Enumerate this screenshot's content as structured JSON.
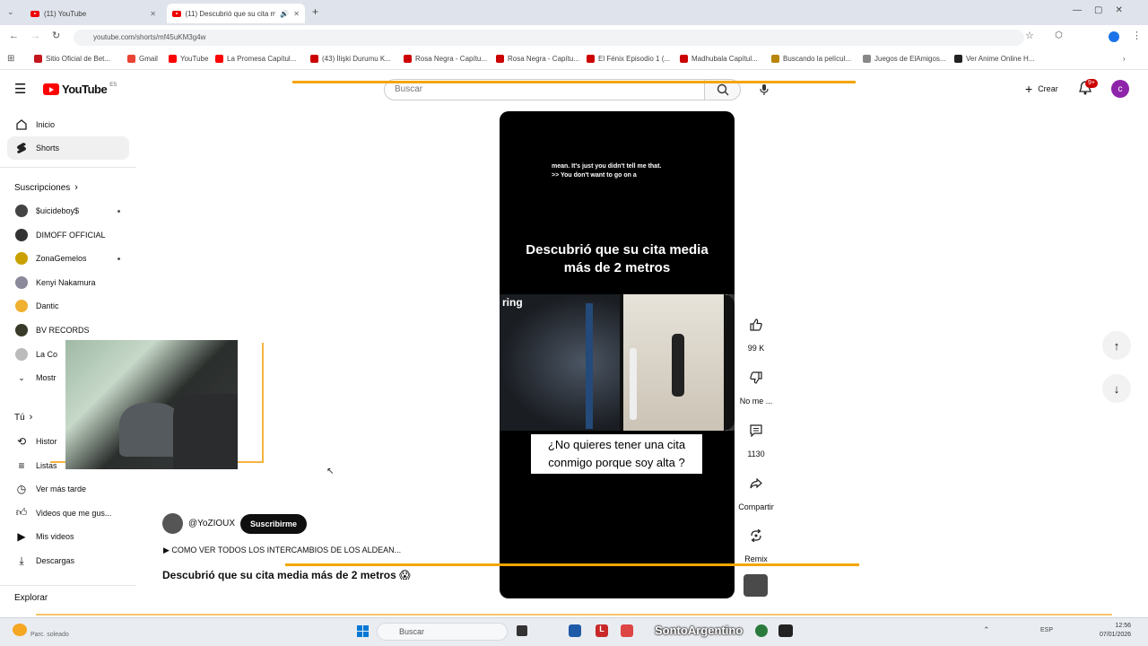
{
  "browser": {
    "tabs": [
      {
        "title": "(11) YouTube",
        "active": false
      },
      {
        "title": "(11) Descubrió que su cita me",
        "active": true
      }
    ],
    "url": "youtube.com/shorts/mf45uKM3g4w",
    "bookmarks": [
      {
        "label": "Sitio Oficial de Bet...",
        "color": "#c4161c"
      },
      {
        "label": "Gmail",
        "color": "#ea4335"
      },
      {
        "label": "YouTube",
        "color": "#ff0000"
      },
      {
        "label": "La Promesa Capítul...",
        "color": "#ff0000"
      },
      {
        "label": "(43) İlişki Durumu K...",
        "color": "#cc0000"
      },
      {
        "label": "Rosa Negra - Capítu...",
        "color": "#cc0000"
      },
      {
        "label": "Rosa Negra - Capítu...",
        "color": "#cc0000"
      },
      {
        "label": "El Fénix Episodio 1 (...",
        "color": "#cc0000"
      },
      {
        "label": "Madhubala Capítul...",
        "color": "#cc0000"
      },
      {
        "label": "Buscando la películ...",
        "color": "#b8860b"
      },
      {
        "label": "Juegos de ElAmigos...",
        "color": "#888888"
      },
      {
        "label": "Ver Anime Online H...",
        "color": "#222222"
      }
    ]
  },
  "header": {
    "logo_text": "YouTube",
    "country": "ES",
    "search_placeholder": "Buscar",
    "create_label": "Crear",
    "notif_count": "9+",
    "avatar_letter": "c"
  },
  "sidebar": {
    "main": [
      {
        "label": "Inicio",
        "icon": "home-icon"
      },
      {
        "label": "Shorts",
        "icon": "shorts-icon",
        "active": true
      }
    ],
    "subs_title": "Suscripciones",
    "subs": [
      {
        "label": "$uicideboy$",
        "color": "#444444",
        "dot": true
      },
      {
        "label": "DIMOFF OFFICIAL",
        "color": "#333333",
        "dot": false
      },
      {
        "label": "ZonaGemelos",
        "color": "#c9a100",
        "dot": true
      },
      {
        "label": "Kenyi Nakamura",
        "color": "#8a8a9a",
        "dot": false
      },
      {
        "label": "Dantic",
        "color": "#f0b030",
        "dot": false
      },
      {
        "label": "BV RECORDS",
        "color": "#3a3a2a",
        "dot": false
      },
      {
        "label": "La Co",
        "color": "#bbbbbb",
        "dot": false
      },
      {
        "label": "Mostr",
        "color": "",
        "dot": false
      }
    ],
    "you_title": "Tú",
    "you": [
      {
        "label": "Histor",
        "icon": "history-icon"
      },
      {
        "label": "Listas",
        "icon": "playlists-icon"
      },
      {
        "label": "Ver más tarde",
        "icon": "watch-later-icon"
      },
      {
        "label": "Videos que me gus...",
        "icon": "like-icon"
      },
      {
        "label": "Mis videos",
        "icon": "my-videos-icon"
      },
      {
        "label": "Descargas",
        "icon": "downloads-icon"
      }
    ],
    "explore_title": "Explorar"
  },
  "short": {
    "caption_line1": "mean. It's just you didn't tell me that.",
    "caption_line2": ">> You don't want to go on a",
    "title_overlay": "Descubrió que su cita media más de 2 metros",
    "frame_text": "ring",
    "subtitle_overlay": "¿No quieres tener una cita conmigo porque soy alta ?",
    "channel": "@YoZIOUX",
    "subscribe": "Suscribirme",
    "playlist": "▶ COMO VER TODOS LOS INTERCAMBIOS DE LOS ALDEAN...",
    "title": "Descubrió que su cita media más de 2 metros 😱"
  },
  "actions": {
    "likes": "99 K",
    "dislike": "No me ...",
    "comments": "1130",
    "share": "Compartir",
    "remix": "Remix"
  },
  "taskbar": {
    "weather": "Parc. soleado",
    "search": "Buscar",
    "stream_name": "SontoArgentino",
    "lang": "ESP",
    "time": "12:56",
    "date": "07/01/2026"
  }
}
